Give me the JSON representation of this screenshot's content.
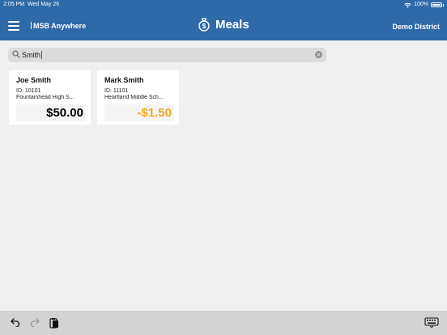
{
  "status_bar": {
    "time": "2:05 PM",
    "date": "Wed May 26",
    "battery": "100%"
  },
  "header": {
    "brand": "MSB Anywhere",
    "title": "Meals",
    "district": "Demo District"
  },
  "search": {
    "query": "Smith"
  },
  "students": [
    {
      "name": "Joe Smith",
      "id": "ID: 10101",
      "school": "Fountainhead High S...",
      "balance": "$50.00",
      "balance_color": "#000000"
    },
    {
      "name": "Mark Smith",
      "id": "ID: 11101",
      "school": "Heartland Middle Sch...",
      "balance": "-$1.50",
      "balance_color": "#f2a91e"
    }
  ],
  "colors": {
    "header_bg": "#2e6aa8",
    "negative_balance": "#f2a91e"
  },
  "toolbar": {
    "icons": [
      "undo-icon",
      "redo-icon",
      "paste-icon",
      "keyboard-icon"
    ]
  }
}
